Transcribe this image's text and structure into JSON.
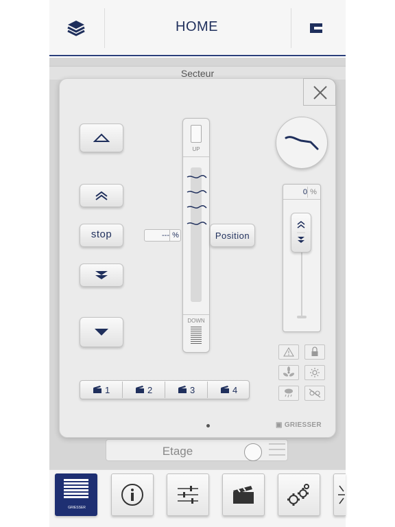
{
  "header": {
    "title": "HOME",
    "layers_icon": "layers-icon",
    "logo_icon": "griesser-e-icon"
  },
  "background": {
    "secteur_label": "Secteur",
    "etage_label": "Etage"
  },
  "controls": {
    "stop_label": "stop",
    "position_label": "Position",
    "position_value": "---",
    "position_unit": "%",
    "up_label": "UP",
    "down_label": "DOWN",
    "tilt_value": "0",
    "tilt_unit": "%"
  },
  "scenes": [
    {
      "label": "1"
    },
    {
      "label": "2"
    },
    {
      "label": "3"
    },
    {
      "label": "4"
    }
  ],
  "status_icons": [
    "warning-icon",
    "lock-icon",
    "wind-icon",
    "sun-icon",
    "rain-icon",
    "frost-icon"
  ],
  "brand": "GRIESSER",
  "bottom_nav": {
    "items": [
      "blinds-icon",
      "info-icon",
      "sliders-icon",
      "clapper-icon",
      "gears-icon",
      "more-icon"
    ],
    "brand_small": "GRIESSER"
  },
  "colors": {
    "accent": "#1f2f5c",
    "nav_active": "#1e2f72"
  }
}
